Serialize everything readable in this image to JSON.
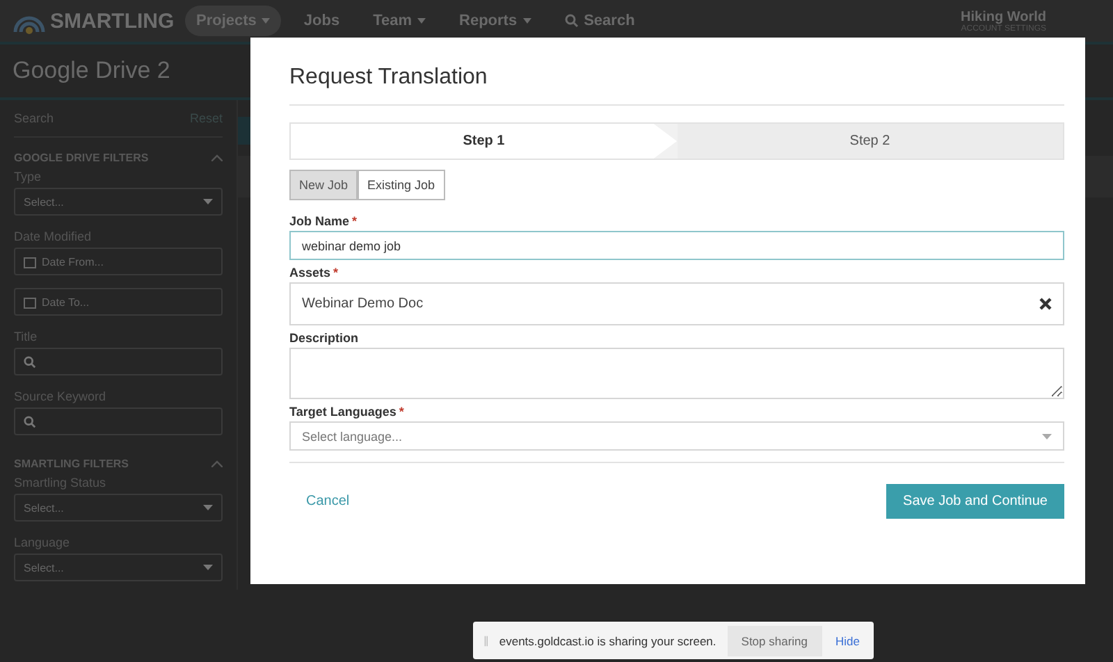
{
  "header": {
    "logo": "SMARTLING",
    "nav": [
      {
        "label": "Projects",
        "dropdown": true,
        "selected": true
      },
      {
        "label": "Jobs",
        "dropdown": false,
        "selected": false
      },
      {
        "label": "Team",
        "dropdown": true,
        "selected": false
      },
      {
        "label": "Reports",
        "dropdown": true,
        "selected": false
      }
    ],
    "search": "Search",
    "account": {
      "name": "Hiking World",
      "sub": "ACCOUNT SETTINGS"
    }
  },
  "page_title": "Google Drive 2",
  "sidebar": {
    "search_label": "Search",
    "reset": "Reset",
    "sections": [
      {
        "title": "GOOGLE DRIVE FILTERS",
        "expanded": true,
        "filters": [
          {
            "label": "Type",
            "kind": "select",
            "fields": [
              "Select..."
            ]
          },
          {
            "label": "Date Modified",
            "kind": "date",
            "fields": [
              "Date From...",
              "Date To..."
            ]
          },
          {
            "label": "Title",
            "kind": "search"
          },
          {
            "label": "Source Keyword",
            "kind": "search"
          }
        ]
      },
      {
        "title": "SMARTLING FILTERS",
        "expanded": true,
        "filters": [
          {
            "label": "Smartling Status",
            "kind": "select",
            "fields": [
              "Select..."
            ]
          },
          {
            "label": "Language",
            "kind": "select",
            "fields": [
              "Select..."
            ]
          }
        ]
      }
    ]
  },
  "modal": {
    "title": "Request Translation",
    "steps": [
      {
        "label": "Step 1",
        "selected": true
      },
      {
        "label": "Step 2",
        "selected": false
      }
    ],
    "job_type": [
      {
        "label": "New Job",
        "selected": true
      },
      {
        "label": "Existing Job",
        "selected": false
      }
    ],
    "fields": [
      {
        "label": "Job Name",
        "required_mark": "*",
        "kind": "text",
        "value": "webinar demo job"
      },
      {
        "label": "Assets",
        "required_mark": "*",
        "kind": "asset",
        "value": "Webinar Demo Doc"
      },
      {
        "label": "Description",
        "kind": "textarea"
      },
      {
        "label": "Target Languages",
        "required_mark": "*",
        "kind": "select",
        "placeholder": "Select language..."
      }
    ],
    "cancel": "Cancel",
    "submit": "Save Job and Continue"
  },
  "share_bar": {
    "message": "events.goldcast.io is sharing your screen.",
    "stop": "Stop sharing",
    "hide": "Hide"
  }
}
